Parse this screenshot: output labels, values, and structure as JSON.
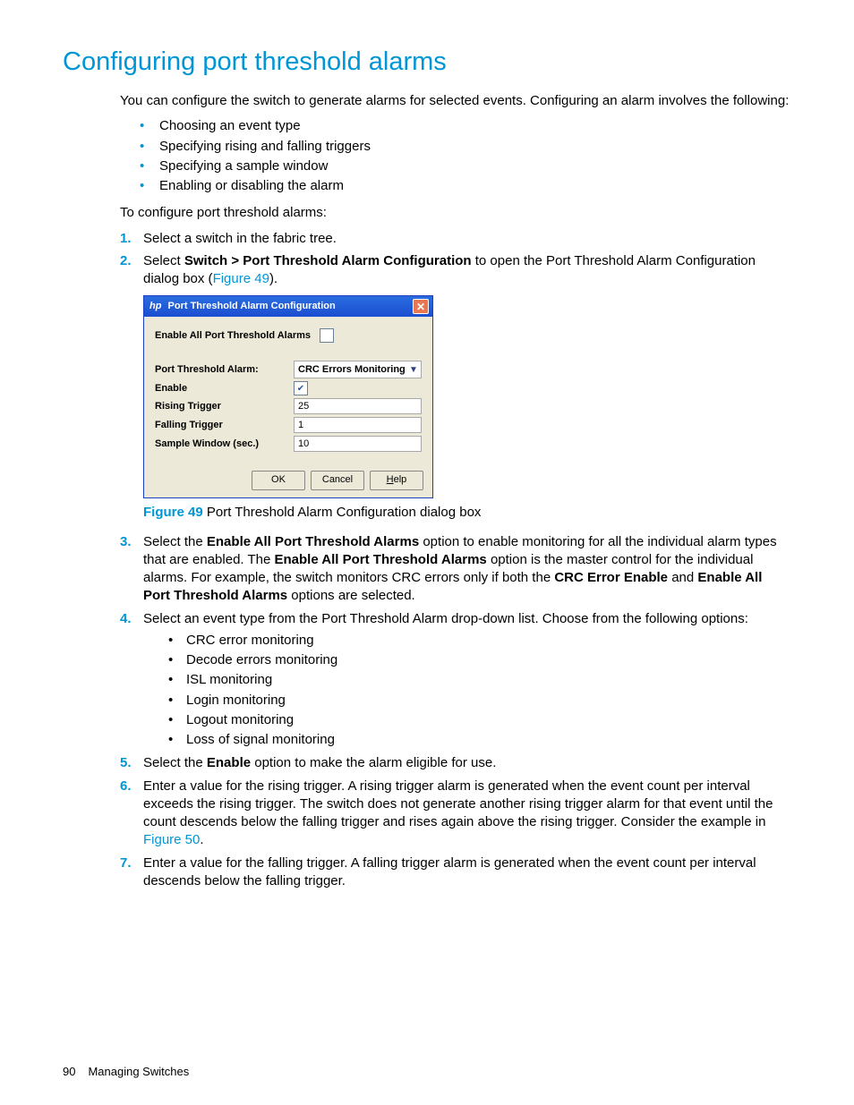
{
  "heading": "Configuring port threshold alarms",
  "intro": "You can configure the switch to generate alarms for selected events. Configuring an alarm involves the following:",
  "intro_bullets": [
    "Choosing an event type",
    "Specifying rising and falling triggers",
    "Specifying a sample window",
    "Enabling or disabling the alarm"
  ],
  "procedure_lead": "To configure port threshold alarms:",
  "step1": "Select a switch in the fabric tree.",
  "step2_a": "Select ",
  "step2_bold": "Switch > Port Threshold Alarm Configuration",
  "step2_b": " to open the Port Threshold Alarm Configuration dialog box (",
  "step2_link": "Figure 49",
  "step2_c": ").",
  "dialog": {
    "title": "Port Threshold Alarm Configuration",
    "enable_all_label": "Enable All Port Threshold Alarms",
    "rows": {
      "alarm_label": "Port Threshold Alarm:",
      "alarm_value": "CRC Errors Monitoring",
      "enable_label": "Enable",
      "rising_label": "Rising Trigger",
      "rising_value": "25",
      "falling_label": "Falling Trigger",
      "falling_value": "1",
      "sample_label": "Sample Window (sec.)",
      "sample_value": "10"
    },
    "buttons": {
      "ok": "OK",
      "cancel": "Cancel",
      "help": "Help"
    }
  },
  "caption_label": "Figure 49",
  "caption_text": " Port Threshold Alarm Configuration dialog box",
  "step3_a": "Select the ",
  "step3_b1": "Enable All Port Threshold Alarms",
  "step3_c": " option to enable monitoring for all the individual alarm types that are enabled. The ",
  "step3_b2": "Enable All Port Threshold Alarms",
  "step3_d": " option is the master control for the individual alarms. For example, the switch monitors CRC errors only if both the ",
  "step3_b3": "CRC Error Enable",
  "step3_e": " and ",
  "step3_b4": "Enable All Port Threshold Alarms",
  "step3_f": " options are selected.",
  "step4_intro": "Select an event type from the Port Threshold Alarm drop-down list. Choose from the following options:",
  "step4_opts": [
    "CRC error monitoring",
    "Decode errors monitoring",
    "ISL monitoring",
    "Login monitoring",
    "Logout monitoring",
    "Loss of signal monitoring"
  ],
  "step5_a": "Select the ",
  "step5_bold": "Enable",
  "step5_b": " option to make the alarm eligible for use.",
  "step6_a": "Enter a value for the rising trigger. A rising trigger alarm is generated when the event count per interval exceeds the rising trigger. The switch does not generate another rising trigger alarm for that event until the count descends below the falling trigger and rises again above the rising trigger. Consider the example in ",
  "step6_link": "Figure 50",
  "step6_b": ".",
  "step7": "Enter a value for the falling trigger. A falling trigger alarm is generated when the event count per interval descends below the falling trigger.",
  "footer": {
    "page": "90",
    "chapter": "Managing Switches"
  }
}
